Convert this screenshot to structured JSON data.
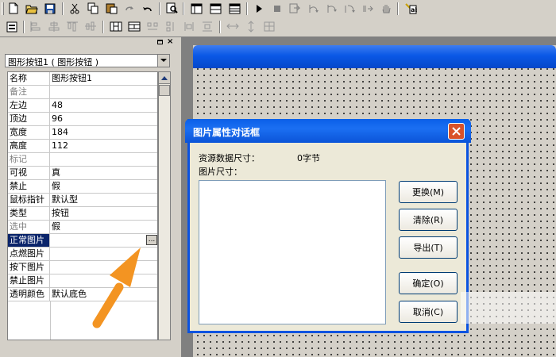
{
  "toolbar": {
    "row1_icons": [
      "new-file-icon",
      "open-folder-icon",
      "save-icon",
      "cut-icon",
      "copy-icon",
      "paste-icon",
      "redo-icon",
      "undo-icon",
      "find-icon",
      "layout-1-icon",
      "layout-2-icon",
      "layout-3-icon",
      "run-icon",
      "stop-icon",
      "step-1-icon",
      "step-2-icon",
      "step-3-icon",
      "step-4-icon",
      "hand-icon",
      "debug-icon"
    ],
    "row2_icons": [
      "form-icon",
      "align-left-icon",
      "align-center-icon",
      "align-top-icon",
      "align-middle-icon",
      "same-width-icon",
      "same-height-icon",
      "space-h-icon",
      "space-v-icon",
      "center-h-icon",
      "center-v-icon",
      "grid-icon"
    ]
  },
  "panel": {
    "object_selector": "图形按钮1 ( 图形按钮 )",
    "properties": [
      {
        "name": "名称",
        "value": "图形按钮1"
      },
      {
        "name": "备注",
        "value": ""
      },
      {
        "name": "左边",
        "value": "48"
      },
      {
        "name": "顶边",
        "value": "96"
      },
      {
        "name": "宽度",
        "value": "184"
      },
      {
        "name": "高度",
        "value": "112"
      },
      {
        "name": "标记",
        "value": ""
      },
      {
        "name": "可视",
        "value": "真"
      },
      {
        "name": "禁止",
        "value": "假"
      },
      {
        "name": "鼠标指针",
        "value": "默认型"
      },
      {
        "name": "类型",
        "value": "按钮"
      },
      {
        "name": "选中",
        "value": "假"
      },
      {
        "name": "正常图片",
        "value": ""
      },
      {
        "name": "点燃图片",
        "value": ""
      },
      {
        "name": "按下图片",
        "value": ""
      },
      {
        "name": "禁止图片",
        "value": ""
      },
      {
        "name": "透明颜色",
        "value": "默认底色"
      }
    ],
    "selected_row": "正常图片",
    "ellipsis_label": "..."
  },
  "dialog": {
    "title": "图片属性对话框",
    "resource_size_label": "资源数据尺寸：",
    "resource_size_value": "0字节",
    "image_size_label": "图片尺寸：",
    "buttons": [
      {
        "label": "更换(M)"
      },
      {
        "label": "清除(R)"
      },
      {
        "label": "导出(T)"
      },
      {
        "label": "确定(O)"
      },
      {
        "label": "取消(C)"
      }
    ]
  },
  "colors": {
    "title_blue": "#0a5fe8",
    "selection": "#0a246a",
    "close_red": "#d9522a",
    "arrow_orange": "#f39422"
  }
}
